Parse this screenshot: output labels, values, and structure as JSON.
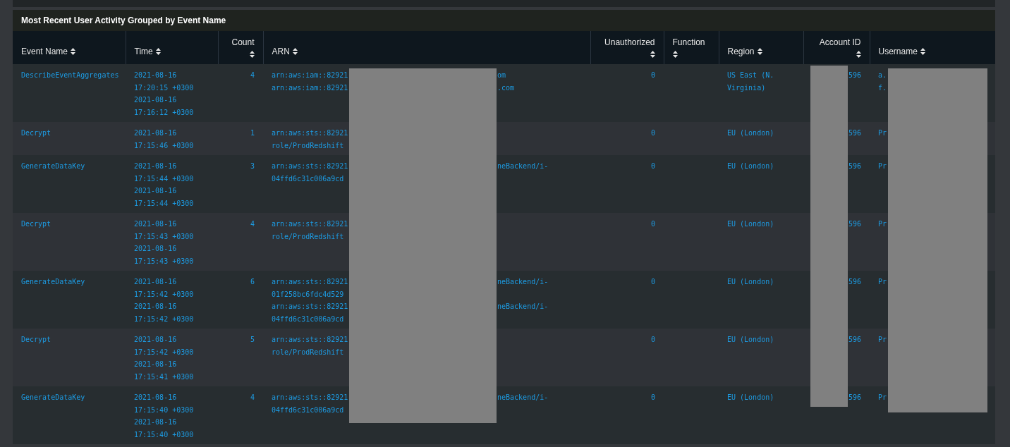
{
  "panel": {
    "title": "Most Recent User Activity Grouped by Event Name"
  },
  "table": {
    "columns": [
      {
        "label": "Event Name"
      },
      {
        "label": "Time"
      },
      {
        "label": "Count"
      },
      {
        "label": "ARN"
      },
      {
        "label": "Unauthorized"
      },
      {
        "label": "Function"
      },
      {
        "label": "Region"
      },
      {
        "label": "Account ID"
      },
      {
        "label": "Username"
      }
    ],
    "rows": [
      {
        "event": "DescribeEventAggregates",
        "times": [
          "2021-08-16 17:20:15 +0300",
          "2021-08-16 17:16:12 +0300"
        ],
        "count": "4",
        "arn": [
          {
            "start": "arn:aws:iam::82921",
            "end": "om"
          },
          {
            "start": "arn:aws:iam::82921",
            "end": ".com"
          }
        ],
        "unauthorized": "0",
        "region": "US East (N. Virginia)",
        "account": "596",
        "username": [
          "a.",
          "f."
        ]
      },
      {
        "event": "Decrypt",
        "times": [
          "2021-08-16 17:15:46 +0300"
        ],
        "count": "1",
        "arn": [
          {
            "start": "arn:aws:sts::82921"
          },
          {
            "start": "role/ProdRedshift"
          }
        ],
        "unauthorized": "0",
        "region": "EU (London)",
        "account": "596",
        "username": [
          "Pr"
        ]
      },
      {
        "event": "GenerateDataKey",
        "times": [
          "2021-08-16 17:15:44 +0300",
          "2021-08-16 17:15:44 +0300"
        ],
        "count": "3",
        "arn": [
          {
            "start": "arn:aws:sts::82921",
            "end": "neBackend/i-"
          },
          {
            "start": "04ffd6c31c006a9cd"
          }
        ],
        "unauthorized": "0",
        "region": "EU (London)",
        "account": "596",
        "username": [
          "Pr"
        ]
      },
      {
        "event": "Decrypt",
        "times": [
          "2021-08-16 17:15:43 +0300",
          "2021-08-16 17:15:43 +0300"
        ],
        "count": "4",
        "arn": [
          {
            "start": "arn:aws:sts::82921"
          },
          {
            "start": "role/ProdRedshift"
          }
        ],
        "unauthorized": "0",
        "region": "EU (London)",
        "account": "596",
        "username": [
          "Pr"
        ]
      },
      {
        "event": "GenerateDataKey",
        "times": [
          "2021-08-16 17:15:42 +0300",
          "2021-08-16 17:15:42 +0300"
        ],
        "count": "6",
        "arn": [
          {
            "start": "arn:aws:sts::82921",
            "end": "neBackend/i-"
          },
          {
            "start": "01f258bc6fdc4d529"
          },
          {
            "start": "arn:aws:sts::82921",
            "end": "neBackend/i-"
          },
          {
            "start": "04ffd6c31c006a9cd"
          }
        ],
        "unauthorized": "0",
        "region": "EU (London)",
        "account": "596",
        "username": [
          "Pr"
        ]
      },
      {
        "event": "Decrypt",
        "times": [
          "2021-08-16 17:15:42 +0300",
          "2021-08-16 17:15:41 +0300"
        ],
        "count": "5",
        "arn": [
          {
            "start": "arn:aws:sts::82921"
          },
          {
            "start": "role/ProdRedshift"
          }
        ],
        "unauthorized": "0",
        "region": "EU (London)",
        "account": "596",
        "username": [
          "Pr"
        ]
      },
      {
        "event": "GenerateDataKey",
        "times": [
          "2021-08-16 17:15:40 +0300",
          "2021-08-16 17:15:40 +0300"
        ],
        "count": "4",
        "arn": [
          {
            "start": "arn:aws:sts::82921",
            "end": "neBackend/i-"
          },
          {
            "start": "04ffd6c31c006a9cd"
          }
        ],
        "unauthorized": "0",
        "region": "EU (London)",
        "account": "596",
        "username": [
          "Pr"
        ]
      }
    ]
  }
}
